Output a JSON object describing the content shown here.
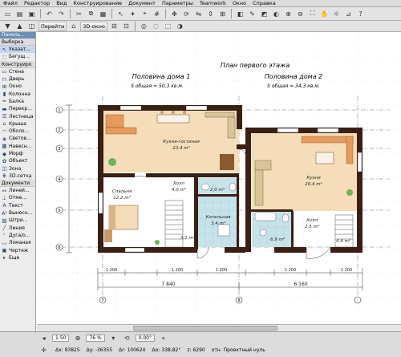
{
  "menu": [
    "Файл",
    "Редактор",
    "Вид",
    "Конструирование",
    "Документ",
    "Параметры",
    "Teamwork",
    "Окно",
    "Справка"
  ],
  "toolbar": {
    "navigate_label": "Перейти",
    "view3d_label": "3D-окно"
  },
  "palette": {
    "title": "Панель...",
    "select_label": "Выборка",
    "pointer_label": "Указат...",
    "marquee_label": "Бегущ...",
    "design_section": "Конструиро",
    "tools": [
      "Стена",
      "Дверь",
      "Окно",
      "Колонна",
      "Балка",
      "Перекр...",
      "Лестница",
      "Крыша",
      "Оболо...",
      "Светов...",
      "Навесн...",
      "Морф",
      "Объект",
      "Зона",
      "3D-сетка"
    ],
    "document_section": "Документи",
    "doc_tools": [
      "Линей...",
      "Отме...",
      "Текст",
      "Выносн...",
      "Штри...",
      "Линия",
      "Дуга/о...",
      "Ломаная",
      "Чертеж"
    ],
    "more_label": "Еще"
  },
  "plan": {
    "title": "План первого этажа",
    "half1_title": "Половина дома 1",
    "half1_area": "S общая = 50,3 кв.м.",
    "half2_title": "Половина дома 2",
    "half2_area": "S общая = 34,3 кв.м.",
    "rooms": [
      {
        "name": "Кухня-гостиная",
        "area": "23,4 m²"
      },
      {
        "name": "Кухня",
        "area": "20,4 m²"
      },
      {
        "name": "Спальня",
        "area": "12,2 m²"
      },
      {
        "name": "Холл",
        "area": "4,0 m²"
      },
      {
        "name": "Котельная",
        "area": "3,4 m²"
      },
      {
        "name": "Холл",
        "area": "2,5 m²"
      },
      {
        "name": "",
        "area": "3,1 m²"
      },
      {
        "name": "",
        "area": "6,9 m²"
      },
      {
        "name": "",
        "area": "2,0 m²"
      },
      {
        "name": "",
        "area": "4,4 m²"
      }
    ],
    "dim_left": "7 840",
    "dim_right": "6 160",
    "dim_small": [
      "1 200",
      "1 200",
      "1 200",
      "1 200",
      "1 200"
    ],
    "axis_labels": [
      "1",
      "2",
      "3",
      "4",
      "5",
      "6",
      "7",
      "8"
    ]
  },
  "status": {
    "scale": "1:50",
    "zoom": "76 %",
    "angle": "0,00°",
    "dx_label": "Δx: 93825",
    "dy_label": "Δy: -36355",
    "r_label": "Δr: 100624",
    "a_label": "Δα: 338,82°",
    "z_label": "z: 6290",
    "ref_label": "отн. Проектный нуль"
  },
  "colors": {
    "wall": "#3a1f14",
    "kitchen_floor": "#f4ddb8",
    "bathroom_tile": "#c8e2ea",
    "sofa": "#e49b5d",
    "accent": "#6b8db8"
  }
}
